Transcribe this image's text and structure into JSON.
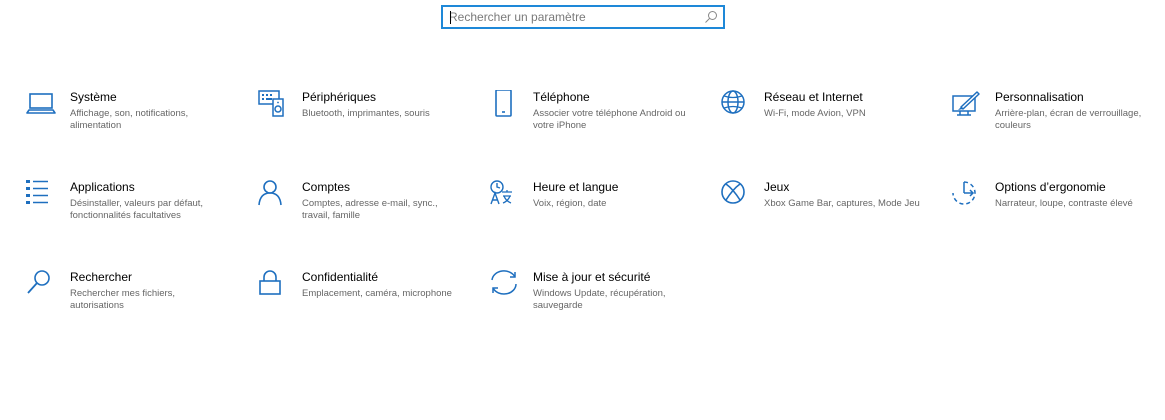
{
  "search": {
    "placeholder": "Rechercher un paramètre",
    "value": ""
  },
  "accent_color": "#1e6fbf",
  "tiles": [
    {
      "icon": "laptop-icon",
      "title": "Système",
      "desc": "Affichage, son, notifications, alimentation"
    },
    {
      "icon": "devices-icon",
      "title": "Périphériques",
      "desc": "Bluetooth, imprimantes, souris"
    },
    {
      "icon": "phone-icon",
      "title": "Téléphone",
      "desc": "Associer votre téléphone Android ou votre iPhone"
    },
    {
      "icon": "globe-icon",
      "title": "Réseau et Internet",
      "desc": "Wi-Fi, mode Avion, VPN"
    },
    {
      "icon": "personalization-icon",
      "title": "Personnalisation",
      "desc": "Arrière-plan, écran de verrouillage, couleurs"
    },
    {
      "icon": "apps-list-icon",
      "title": "Applications",
      "desc": "Désinstaller, valeurs par défaut, fonctionnalités facultatives"
    },
    {
      "icon": "person-icon",
      "title": "Comptes",
      "desc": "Comptes, adresse e-mail, sync., travail, famille"
    },
    {
      "icon": "language-icon",
      "title": "Heure et langue",
      "desc": "Voix, région, date"
    },
    {
      "icon": "xbox-icon",
      "title": "Jeux",
      "desc": "Xbox Game Bar, captures, Mode Jeu"
    },
    {
      "icon": "accessibility-icon",
      "title": "Options d’ergonomie",
      "desc": "Narrateur, loupe, contraste élevé"
    },
    {
      "icon": "search-icon",
      "title": "Rechercher",
      "desc": "Rechercher mes fichiers, autorisations"
    },
    {
      "icon": "lock-icon",
      "title": "Confidentialité",
      "desc": "Emplacement, caméra, microphone"
    },
    {
      "icon": "sync-icon",
      "title": "Mise à jour et sécurité",
      "desc": "Windows Update, récupération, sauvegarde"
    }
  ]
}
